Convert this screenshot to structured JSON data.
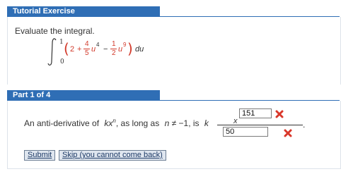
{
  "tutorial": {
    "header": "Tutorial Exercise",
    "instruction": "Evaluate the integral."
  },
  "integral": {
    "lower": "0",
    "upper": "1",
    "open_paren": "(",
    "term1": "2",
    "plus": "+",
    "frac1_num": "4",
    "frac1_den": "5",
    "var1": "u",
    "exp1": "4",
    "minus": "−",
    "frac2_num": "1",
    "frac2_den": "2",
    "var2": "u",
    "exp2": "9",
    "close_paren": ")",
    "differential": "du"
  },
  "part": {
    "header": "Part 1 of 4",
    "prompt_prefix": "An anti-derivative of",
    "prompt_kx": "kx",
    "prompt_n": "n",
    "prompt_mid": ",  as long as",
    "prompt_cond": " ≠ −1,  is",
    "prompt_k": "k",
    "frac_x": "x",
    "numerator_value": "151",
    "denominator_value": "50",
    "period": "."
  },
  "buttons": {
    "submit": "Submit",
    "skip": "Skip (you cannot come back)"
  },
  "colors": {
    "header_blue": "#2f6eb5",
    "error_red": "#d9372a",
    "math_red": "#d23a2b"
  },
  "icons": {
    "incorrect": "x-mark-icon"
  }
}
